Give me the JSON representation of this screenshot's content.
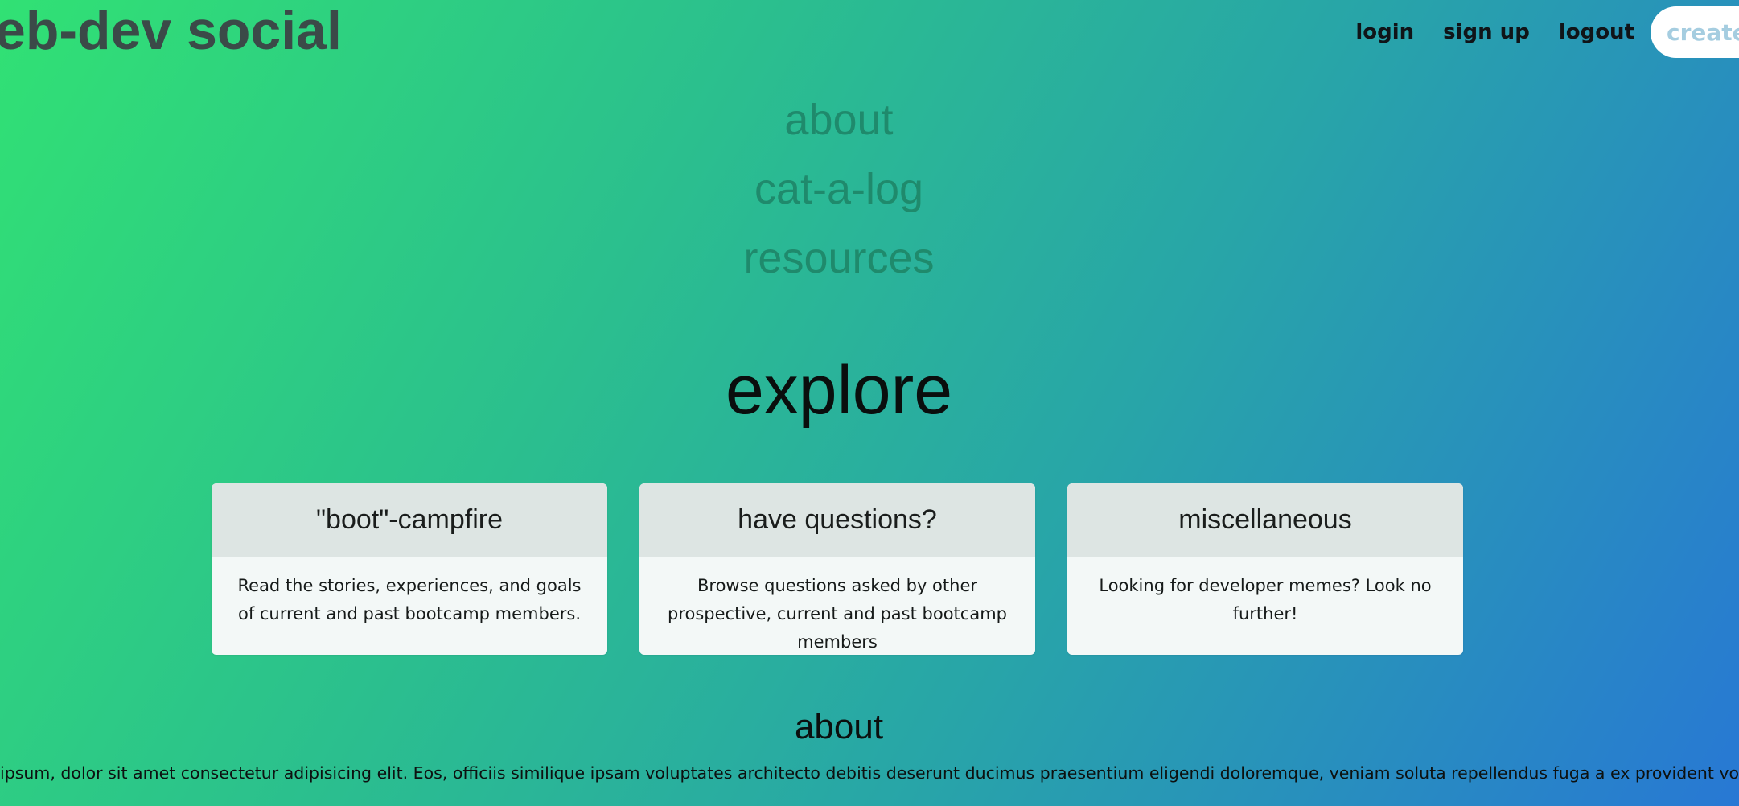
{
  "header": {
    "site_title": "eb-dev social",
    "nav": {
      "login": "login",
      "sign_up": "sign up",
      "logout": "logout",
      "create": "create"
    }
  },
  "main_nav": {
    "items": [
      {
        "label": "about"
      },
      {
        "label": "cat-a-log"
      },
      {
        "label": "resources"
      }
    ]
  },
  "explore": {
    "title": "explore",
    "cards": [
      {
        "title": "\"boot\"-campfire",
        "body": "Read the stories, experiences, and goals of current and past bootcamp members."
      },
      {
        "title": "have questions?",
        "body": "Browse questions asked by other prospective, current and past bootcamp members"
      },
      {
        "title": "miscellaneous",
        "body": "Looking for developer memes? Look no further!"
      }
    ]
  },
  "about": {
    "title": "about",
    "text": "ipsum, dolor sit amet consectetur adipisicing elit. Eos, officiis similique ipsam voluptates architecto debitis deserunt ducimus praesentium eligendi doloremque, veniam soluta repellendus fuga a ex provident voluptatem alias enim."
  },
  "colors": {
    "gradient_start": "#31e174",
    "gradient_end": "#2878d4",
    "title_text": "#3b4a48",
    "nav_link": "#1f8a6c",
    "create_text": "#a5cde0"
  }
}
